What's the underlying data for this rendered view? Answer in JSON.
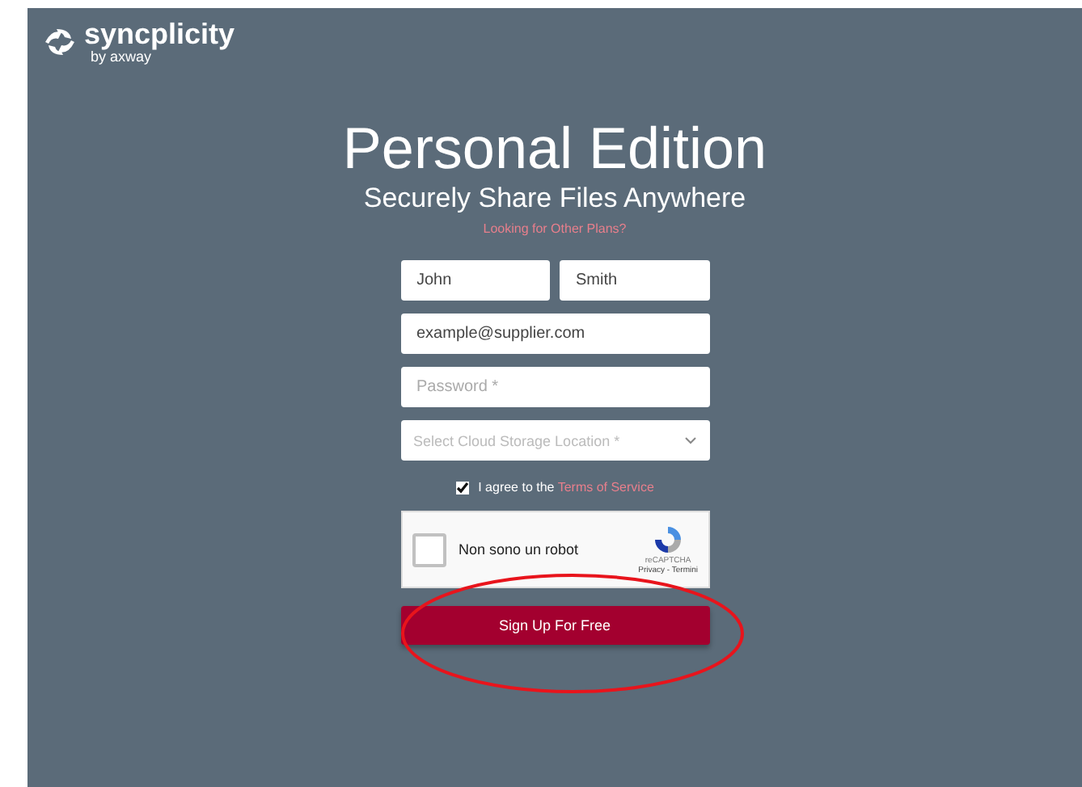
{
  "logo": {
    "name": "syncplicity",
    "byline": "by axway"
  },
  "heading": {
    "title": "Personal Edition",
    "subtitle": "Securely Share Files Anywhere",
    "link": "Looking for Other Plans?"
  },
  "form": {
    "first_name": {
      "value": "John"
    },
    "last_name": {
      "value": "Smith"
    },
    "email": {
      "value": "example@supplier.com"
    },
    "password": {
      "placeholder": "Password *"
    },
    "storage_location": {
      "placeholder": "Select Cloud Storage Location *"
    },
    "terms": {
      "checked": true,
      "text": "I agree to the",
      "link": "Terms of Service"
    },
    "captcha": {
      "checked": false,
      "label": "Non sono un robot",
      "brand": "reCAPTCHA",
      "links": "Privacy - Termini"
    },
    "submit": "Sign Up For Free"
  },
  "annotation": {
    "kind": "ellipse"
  }
}
